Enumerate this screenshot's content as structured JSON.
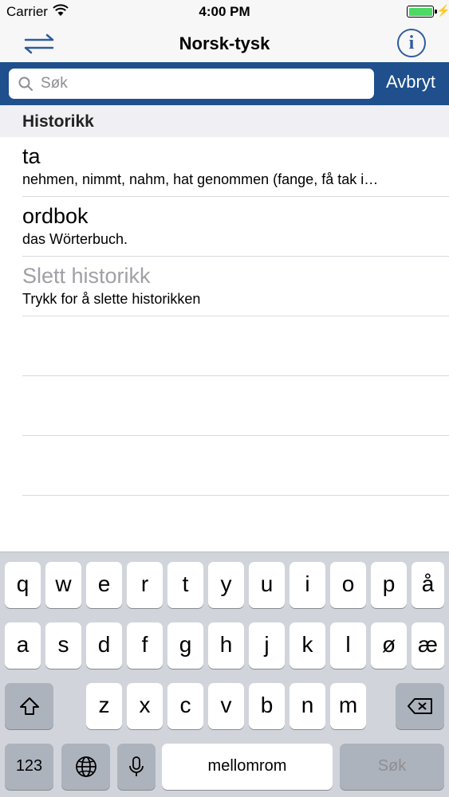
{
  "status_bar": {
    "carrier": "Carrier",
    "time": "4:00 PM",
    "icons": [
      "wifi-icon",
      "battery-icon",
      "charging-bolt-icon"
    ]
  },
  "nav_bar": {
    "title": "Norsk-tysk",
    "left_icon": "swap-direction-icon",
    "right_icon": "info-icon",
    "info_glyph": "i",
    "accent_color": "#2f5d9c"
  },
  "search": {
    "placeholder": "Søk",
    "value": "",
    "cancel_label": "Avbryt",
    "bar_color": "#1f4f8c"
  },
  "history": {
    "section_title": "Historikk",
    "items": [
      {
        "title": "ta",
        "subtitle": "nehmen, nimmt, nahm, hat genommen (fange, få tak i…"
      },
      {
        "title": "ordbok",
        "subtitle": "das Wörterbuch."
      }
    ],
    "clear": {
      "title": "Slett historikk",
      "subtitle": "Trykk for å slette historikken"
    }
  },
  "keyboard": {
    "row1": [
      "q",
      "w",
      "e",
      "r",
      "t",
      "y",
      "u",
      "i",
      "o",
      "p",
      "å"
    ],
    "row2": [
      "a",
      "s",
      "d",
      "f",
      "g",
      "h",
      "j",
      "k",
      "l",
      "ø",
      "æ"
    ],
    "row3": [
      "z",
      "x",
      "c",
      "v",
      "b",
      "n",
      "m"
    ],
    "numbers_label": "123",
    "space_label": "mellomrom",
    "return_label": "Søk",
    "icons": [
      "shift-icon",
      "backspace-icon",
      "globe-icon",
      "microphone-icon"
    ]
  }
}
